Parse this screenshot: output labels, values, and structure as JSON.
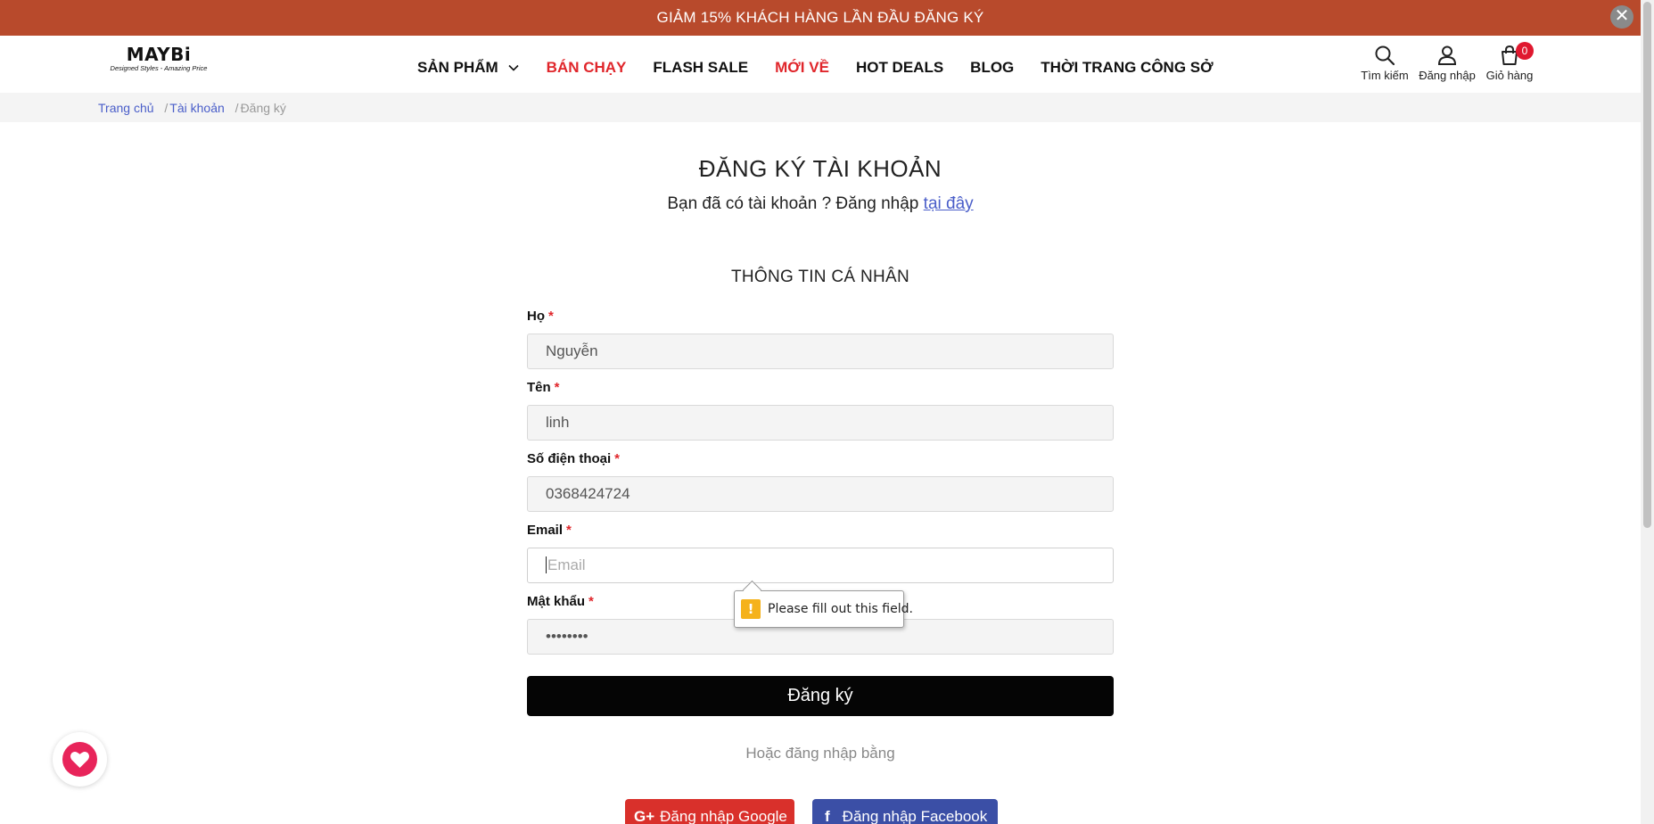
{
  "promo": {
    "text": "GIẢM 15% KHÁCH HÀNG LẦN ĐẦU ĐĂNG KÝ",
    "close": "✕"
  },
  "logo": {
    "name": "MAYBi",
    "tagline": "Designed Styles - Amazing Price"
  },
  "nav": [
    {
      "label": "SẢN PHẨM",
      "dropdown": true,
      "color": "#111111"
    },
    {
      "label": "BÁN CHẠY",
      "color": "#e0262b"
    },
    {
      "label": "FLASH SALE",
      "color": "#111111"
    },
    {
      "label": "MỚI VỀ",
      "color": "#e0262b"
    },
    {
      "label": "HOT DEALS",
      "color": "#111111"
    },
    {
      "label": "BLOG",
      "color": "#111111"
    },
    {
      "label": "THỜI TRANG CÔNG SỞ",
      "color": "#111111"
    }
  ],
  "header_icons": {
    "search": {
      "label": "Tìm kiếm",
      "icon": "search-icon"
    },
    "login": {
      "label": "Đăng nhập",
      "icon": "user-icon"
    },
    "cart": {
      "label": "Giỏ hàng",
      "icon": "cart-icon",
      "count": "0"
    }
  },
  "breadcrumb": {
    "home": "Trang chủ",
    "account": "Tài khoản",
    "current": "Đăng ký",
    "separator": "/"
  },
  "page": {
    "title": "ĐĂNG KÝ TÀI KHOẢN",
    "subtitle_text": "Bạn đã có tài khoản ? Đăng nhập ",
    "subtitle_link": "tại đây",
    "section": "THÔNG TIN CÁ NHÂN"
  },
  "form": {
    "required_mark": "*",
    "last_name": {
      "label": "Họ",
      "value": "Nguyễn"
    },
    "first_name": {
      "label": "Tên",
      "value": "linh"
    },
    "phone": {
      "label": "Số điện thoại",
      "value": "0368424724"
    },
    "email": {
      "label": "Email",
      "value": "",
      "placeholder": "Email"
    },
    "password": {
      "label": "Mật khẩu",
      "value": "••••••••"
    },
    "submit": "Đăng ký",
    "validation_message": "Please fill out this field."
  },
  "social": {
    "or_text": "Hoặc đăng nhập bằng",
    "google": {
      "label": "Đăng nhập Google",
      "glyph": "G+",
      "color": "#d9302b"
    },
    "facebook": {
      "label": "Đăng nhập Facebook",
      "glyph": "f",
      "color": "#3b4fa6"
    }
  },
  "colors": {
    "promo_bg": "#b84a2c",
    "accent_red": "#e0262b",
    "link_blue": "#4a5ec9",
    "wishlist": "#e8245a"
  }
}
